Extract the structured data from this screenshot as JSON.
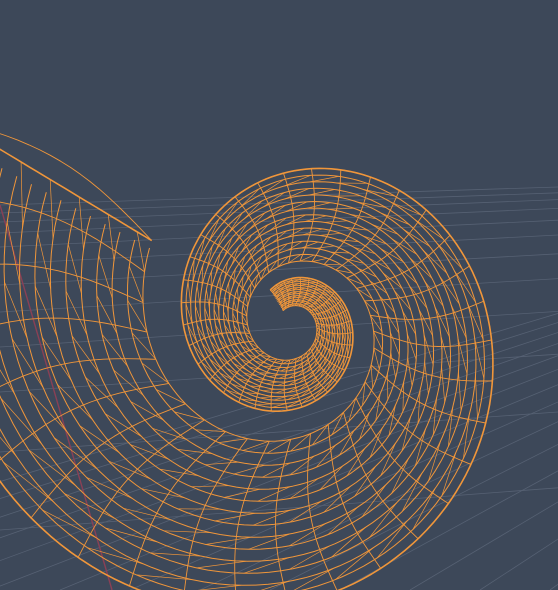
{
  "viewport": {
    "mode": "wireframe",
    "background_color": "#3d4859",
    "grid_color": "#566173",
    "axis_color": "#8a4055",
    "wire_color": "#f0963a"
  },
  "object": {
    "shape_icon": "nautilus-shell-icon",
    "shading": "wireframe"
  }
}
